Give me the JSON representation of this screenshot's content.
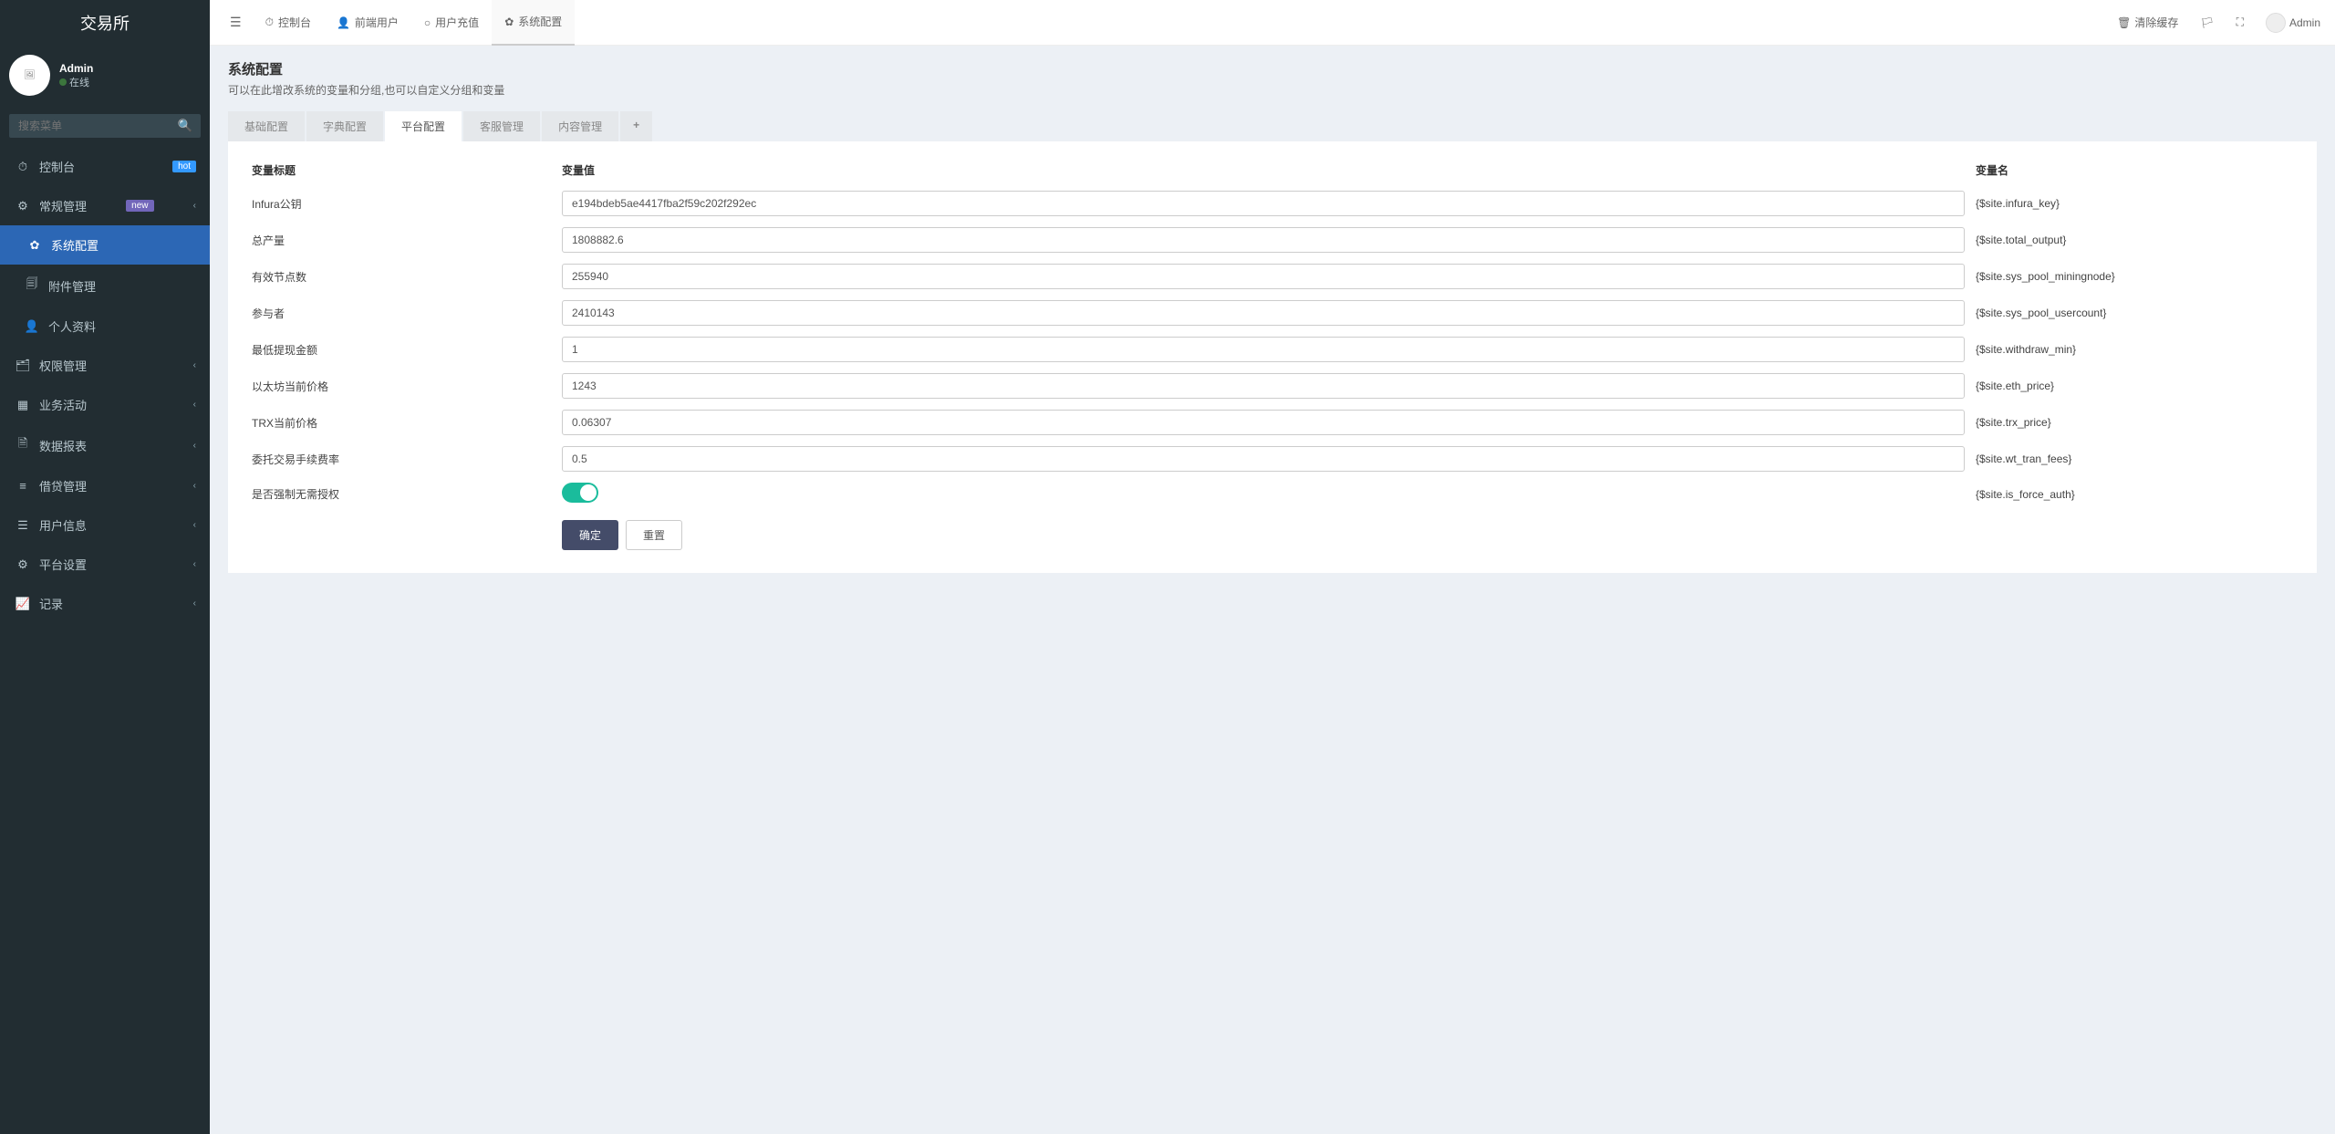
{
  "app_name": "交易所",
  "user": {
    "name": "Admin",
    "status": "在线"
  },
  "search": {
    "placeholder": "搜索菜单"
  },
  "sidebar": {
    "items": [
      {
        "icon": "⏱",
        "label": "控制台",
        "badge": "hot",
        "badge_style": "hot"
      },
      {
        "icon": "⚙",
        "label": "常规管理",
        "badge": "new",
        "badge_style": "new",
        "caret": true
      },
      {
        "icon": "✿",
        "label": "系统配置",
        "active": true,
        "sub": true
      },
      {
        "icon": "🗐",
        "label": "附件管理",
        "sub": true
      },
      {
        "icon": "👤",
        "label": "个人资料",
        "sub": true
      },
      {
        "icon": "🗂",
        "label": "权限管理",
        "caret": true
      },
      {
        "icon": "▦",
        "label": "业务活动",
        "caret": true
      },
      {
        "icon": "🗎",
        "label": "数据报表",
        "caret": true
      },
      {
        "icon": "≡",
        "label": "借贷管理",
        "caret": true
      },
      {
        "icon": "☰",
        "label": "用户信息",
        "caret": true
      },
      {
        "icon": "⚙",
        "label": "平台设置",
        "caret": true
      },
      {
        "icon": "📈",
        "label": "记录",
        "caret": true
      }
    ]
  },
  "topnav": {
    "tabs": [
      {
        "icon": "⏱",
        "label": "控制台"
      },
      {
        "icon": "👤",
        "label": "前端用户"
      },
      {
        "icon": "○",
        "label": "用户充值"
      },
      {
        "icon": "✿",
        "label": "系统配置",
        "active": true
      }
    ],
    "right": {
      "clear_cache": "清除缓存",
      "username": "Admin"
    }
  },
  "page": {
    "title": "系统配置",
    "subtitle": "可以在此增改系统的变量和分组,也可以自定义分组和变量"
  },
  "config_tabs": [
    "基础配置",
    "字典配置",
    "平台配置",
    "客服管理",
    "内容管理"
  ],
  "config_active_index": 2,
  "table": {
    "headers": {
      "label": "变量标题",
      "value": "变量值",
      "name": "变量名"
    },
    "rows": [
      {
        "label": "Infura公钥",
        "value": "e194bdeb5ae4417fba2f59c202f292ec",
        "name": "{$site.infura_key}",
        "type": "text"
      },
      {
        "label": "总产量",
        "value": "1808882.6",
        "name": "{$site.total_output}",
        "type": "text"
      },
      {
        "label": "有效节点数",
        "value": "255940",
        "name": "{$site.sys_pool_miningnode}",
        "type": "text"
      },
      {
        "label": "参与者",
        "value": "2410143",
        "name": "{$site.sys_pool_usercount}",
        "type": "text"
      },
      {
        "label": "最低提现金额",
        "value": "1",
        "name": "{$site.withdraw_min}",
        "type": "text"
      },
      {
        "label": "以太坊当前价格",
        "value": "1243",
        "name": "{$site.eth_price}",
        "type": "text"
      },
      {
        "label": "TRX当前价格",
        "value": "0.06307",
        "name": "{$site.trx_price}",
        "type": "text"
      },
      {
        "label": "委托交易手续费率",
        "value": "0.5",
        "name": "{$site.wt_tran_fees}",
        "type": "text"
      },
      {
        "label": "是否强制无需授权",
        "value": true,
        "name": "{$site.is_force_auth}",
        "type": "switch"
      }
    ],
    "buttons": {
      "confirm": "确定",
      "reset": "重置"
    }
  }
}
